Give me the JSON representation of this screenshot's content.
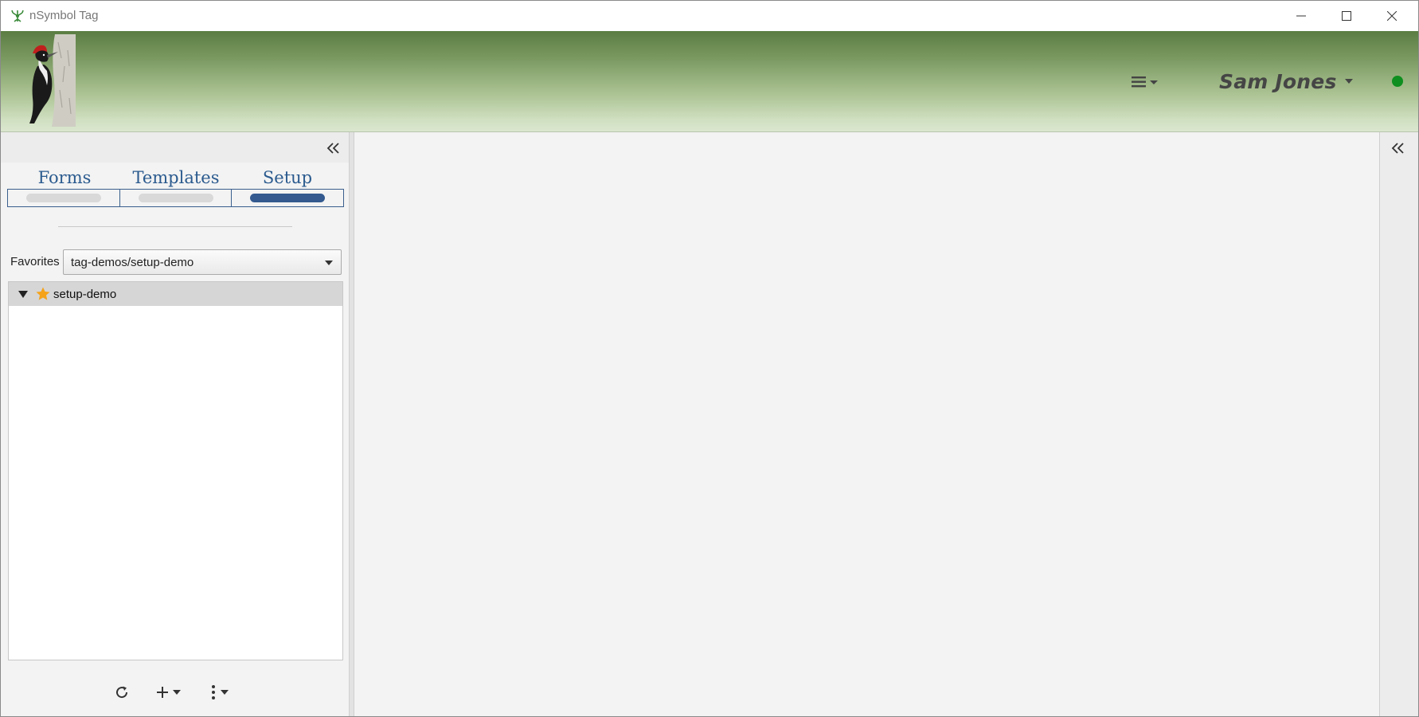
{
  "window": {
    "title": "nSymbol Tag"
  },
  "header": {
    "user_name": "Sam Jones",
    "status_color": "#0f8f1f"
  },
  "tabs": [
    {
      "label": "Forms",
      "active": false
    },
    {
      "label": "Templates",
      "active": false
    },
    {
      "label": "Setup",
      "active": true
    }
  ],
  "favorites": {
    "label": "Favorites",
    "selected": "tag-demos/setup-demo"
  },
  "tree": {
    "items": [
      {
        "label": "setup-demo",
        "expanded": true,
        "favorite": true
      }
    ]
  },
  "colors": {
    "accent": "#345a8f",
    "tab_text": "#2a5a8e",
    "star": "#f5a31a"
  },
  "icons": [
    "app-icon",
    "minimize-icon",
    "maximize-icon",
    "close-icon",
    "woodpecker-logo",
    "hamburger-menu-icon",
    "double-chevron-left-icon",
    "star-icon",
    "refresh-icon",
    "plus-icon",
    "kebab-menu-icon"
  ]
}
